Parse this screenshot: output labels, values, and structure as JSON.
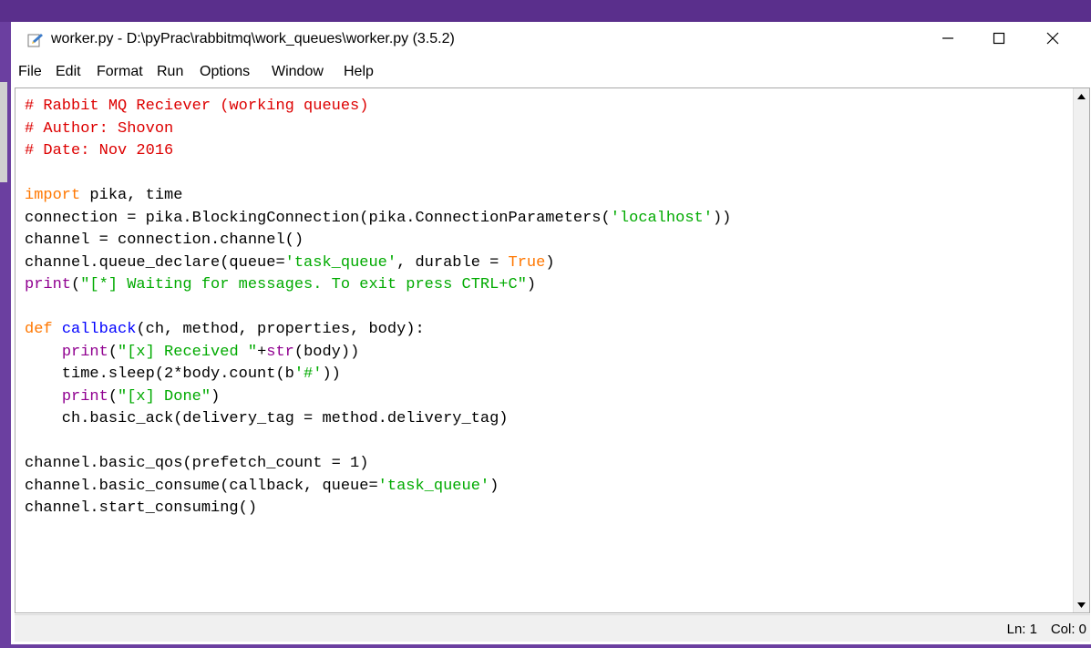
{
  "window": {
    "title": "worker.py - D:\\pyPrac\\rabbitmq\\work_queues\\worker.py (3.5.2)",
    "icon": "python-file-icon",
    "controls": {
      "minimize": "—",
      "maximize": "☐",
      "close": "✕"
    }
  },
  "menu": {
    "items": [
      "File",
      "Edit",
      "Format",
      "Run",
      "Options",
      "Window",
      "Help"
    ]
  },
  "editor": {
    "lines": [
      [
        {
          "t": "# Rabbit MQ Reciever (working queues)",
          "c": "comment"
        }
      ],
      [
        {
          "t": "# Author: Shovon",
          "c": "comment"
        }
      ],
      [
        {
          "t": "# Date: Nov 2016",
          "c": "comment"
        }
      ],
      [],
      [
        {
          "t": "import",
          "c": "kw"
        },
        {
          "t": " pika, time",
          "c": "plain"
        }
      ],
      [
        {
          "t": "connection = pika.BlockingConnection(pika.ConnectionParameters(",
          "c": "plain"
        },
        {
          "t": "'localhost'",
          "c": "str"
        },
        {
          "t": "))",
          "c": "plain"
        }
      ],
      [
        {
          "t": "channel = connection.channel()",
          "c": "plain"
        }
      ],
      [
        {
          "t": "channel.queue_declare(queue=",
          "c": "plain"
        },
        {
          "t": "'task_queue'",
          "c": "str"
        },
        {
          "t": ", durable = ",
          "c": "plain"
        },
        {
          "t": "True",
          "c": "kw"
        },
        {
          "t": ")",
          "c": "plain"
        }
      ],
      [
        {
          "t": "print",
          "c": "builtin"
        },
        {
          "t": "(",
          "c": "plain"
        },
        {
          "t": "\"[*] Waiting for messages. To exit press CTRL+C\"",
          "c": "str"
        },
        {
          "t": ")",
          "c": "plain"
        }
      ],
      [],
      [
        {
          "t": "def",
          "c": "kw"
        },
        {
          "t": " ",
          "c": "plain"
        },
        {
          "t": "callback",
          "c": "def"
        },
        {
          "t": "(ch, method, properties, body):",
          "c": "plain"
        }
      ],
      [
        {
          "t": "    ",
          "c": "plain"
        },
        {
          "t": "print",
          "c": "builtin"
        },
        {
          "t": "(",
          "c": "plain"
        },
        {
          "t": "\"[x] Received \"",
          "c": "str"
        },
        {
          "t": "+",
          "c": "plain"
        },
        {
          "t": "str",
          "c": "builtin"
        },
        {
          "t": "(body))",
          "c": "plain"
        }
      ],
      [
        {
          "t": "    time.sleep(2*body.count(b",
          "c": "plain"
        },
        {
          "t": "'#'",
          "c": "str"
        },
        {
          "t": "))",
          "c": "plain"
        }
      ],
      [
        {
          "t": "    ",
          "c": "plain"
        },
        {
          "t": "print",
          "c": "builtin"
        },
        {
          "t": "(",
          "c": "plain"
        },
        {
          "t": "\"[x] Done\"",
          "c": "str"
        },
        {
          "t": ")",
          "c": "plain"
        }
      ],
      [
        {
          "t": "    ch.basic_ack(delivery_tag = method.delivery_tag)",
          "c": "plain"
        }
      ],
      [],
      [
        {
          "t": "channel.basic_qos(prefetch_count = 1)",
          "c": "plain"
        }
      ],
      [
        {
          "t": "channel.basic_consume(callback, queue=",
          "c": "plain"
        },
        {
          "t": "'task_queue'",
          "c": "str"
        },
        {
          "t": ")",
          "c": "plain"
        }
      ],
      [
        {
          "t": "channel.start_consuming()",
          "c": "plain"
        }
      ]
    ]
  },
  "status": {
    "ln": "Ln: 1",
    "col": "Col: 0"
  },
  "colors": {
    "desktop": "#6b3fa0",
    "comment": "#dd0000",
    "keyword": "#ff7700",
    "string": "#00aa00",
    "builtin": "#900090",
    "definition": "#0000ff"
  }
}
